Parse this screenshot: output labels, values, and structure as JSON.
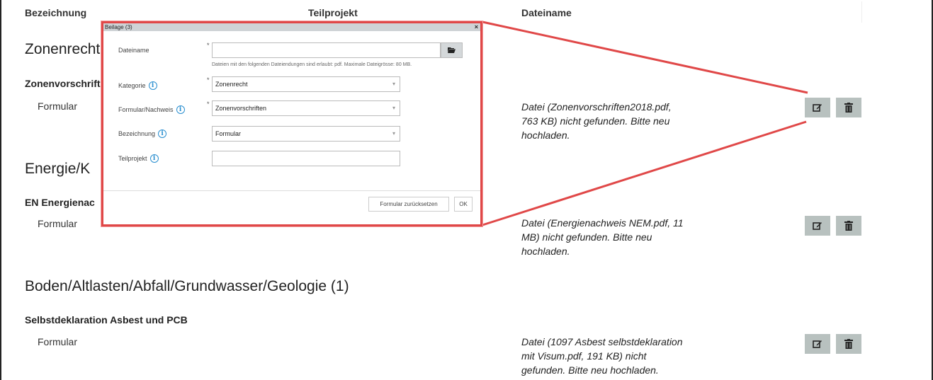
{
  "table_header": {
    "bezeichnung": "Bezeichnung",
    "teilprojekt": "Teilprojekt",
    "dateiname": "Dateiname"
  },
  "sections": [
    {
      "title": "Zonenrecht",
      "group": "Zonenvorschriften",
      "row_label": "Formular",
      "status_lines": [
        "Datei (Zonenvorschriften2018.pdf,",
        "763 KB) nicht gefunden. Bitte neu",
        "hochladen."
      ]
    },
    {
      "title": "Energie/K",
      "group": "EN Energienac",
      "row_label": "Formular",
      "status_lines": [
        "Datei (Energienachweis NEM.pdf, 11",
        "MB) nicht gefunden. Bitte neu",
        "hochladen."
      ]
    },
    {
      "title": "Boden/Altlasten/Abfall/Grundwasser/Geologie (1)",
      "group": "Selbstdeklaration Asbest und PCB",
      "row_label": "Formular",
      "status_lines": [
        "Datei (1097 Asbest selbstdeklaration",
        "mit Visum.pdf, 191 KB) nicht",
        "gefunden. Bitte neu hochladen."
      ]
    }
  ],
  "icons": {
    "edit": "edit-icon",
    "delete": "trash-icon",
    "folder": "folder-open-icon",
    "info": "info-icon"
  },
  "dialog": {
    "title": "Beilage (3)",
    "close": "×",
    "fields": {
      "dateiname": {
        "label": "Dateiname",
        "required": "*",
        "value": ""
      },
      "hint": "Dateien mit den folgenden Dateiendungen sind erlaubt: pdf. Maximale Dateigrösse: 80 MB.",
      "kategorie": {
        "label": "Kategorie",
        "required": "*",
        "value": "Zonenrecht"
      },
      "formular": {
        "label": "Formular/Nachweis",
        "required": "*",
        "value": "Zonenvorschriften"
      },
      "bezeichnung": {
        "label": "Bezeichnung",
        "value": "Formular"
      },
      "teilprojekt": {
        "label": "Teilprojekt",
        "value": ""
      }
    },
    "reset_label": "Formular zurücksetzen",
    "ok_label": "OK"
  },
  "colors": {
    "highlight": "#e04848",
    "action_button": "#b8c1bf",
    "info": "#2a8fd0"
  }
}
